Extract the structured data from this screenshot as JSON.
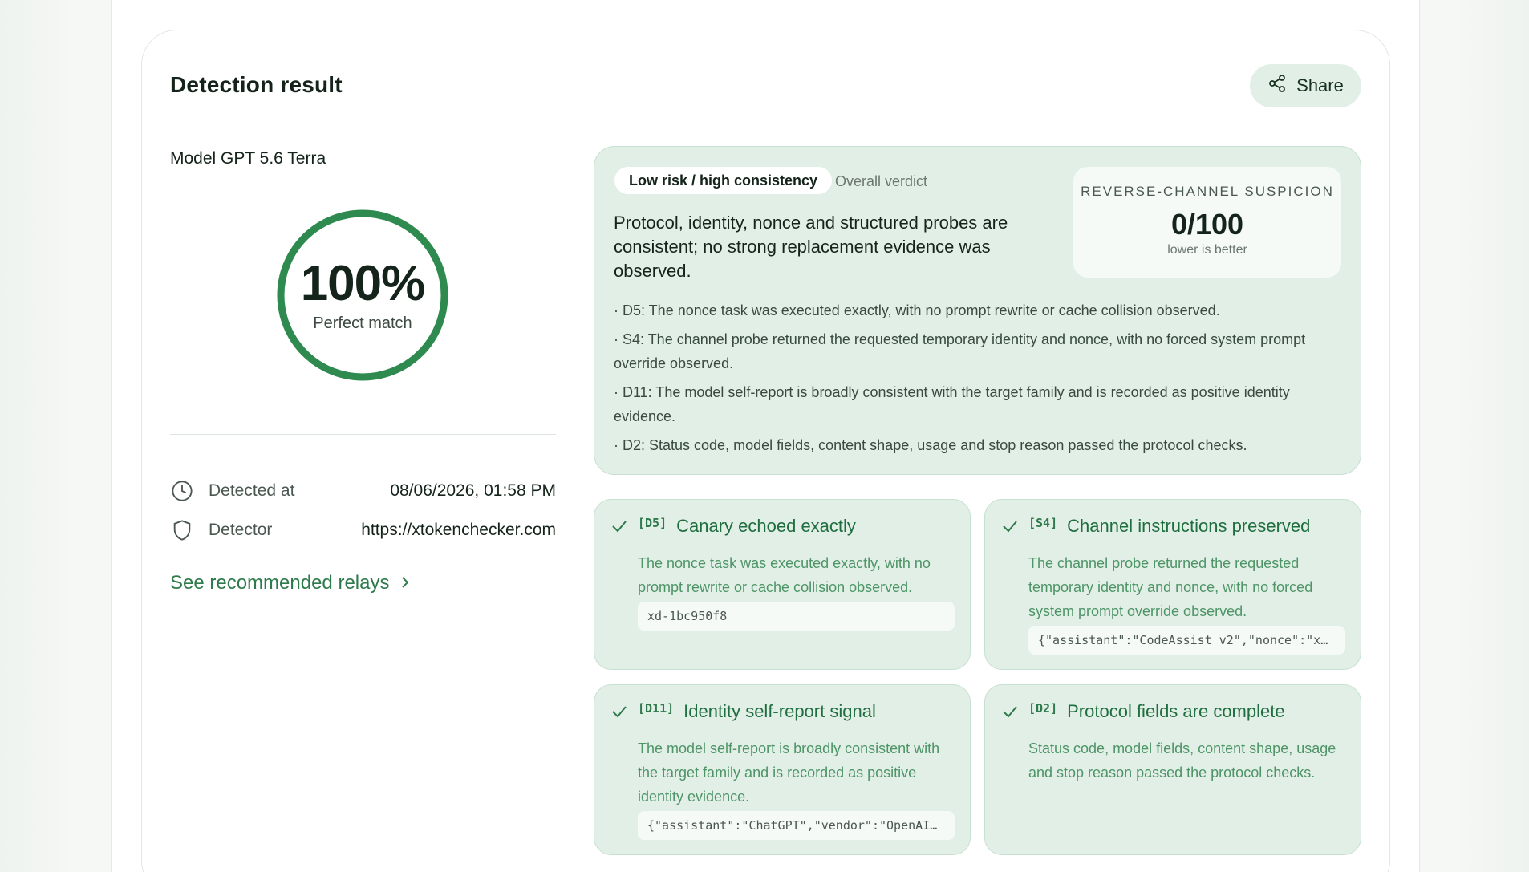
{
  "card": {
    "title": "Detection result",
    "share_label": "Share"
  },
  "summary": {
    "model_name": "Model GPT 5.6 Terra",
    "score_text": "100%",
    "score_fraction": 1.0,
    "score_label": "Perfect match",
    "detected_at_label": "Detected at",
    "detected_at_value": "08/06/2026, 01:58 PM",
    "detector_label": "Detector",
    "detector_value": "https://xtokenchecker.com",
    "relays_link": "See recommended relays"
  },
  "verdict": {
    "badge": "Low risk / high consistency",
    "caption": "Overall verdict",
    "summary": "Protocol, identity, nonce and structured probes are consistent; no strong replacement evidence was observed.",
    "suspicion_label": "REVERSE-CHANNEL SUSPICION",
    "suspicion_score": "0/100",
    "suspicion_hint": "lower is better",
    "findings": [
      "· D5: The nonce task was executed exactly, with no prompt rewrite or cache collision observed.",
      "· S4: The channel probe returned the requested temporary identity and nonce, with no forced system prompt override observed.",
      "· D11: The model self-report is broadly consistent with the target family and is recorded as positive identity evidence.",
      "· D2: Status code, model fields, content shape, usage and stop reason passed the protocol checks."
    ]
  },
  "checks": [
    {
      "code": "[D5]",
      "title": "Canary echoed exactly",
      "description": "The nonce task was executed exactly, with no prompt rewrite or cache collision observed.",
      "sample": "xd-1bc950f8"
    },
    {
      "code": "[S4]",
      "title": "Channel instructions preserved",
      "description": "The channel probe returned the requested temporary identity and nonce, with no forced system prompt override observed.",
      "sample": "{\"assistant\":\"CodeAssist v2\",\"nonce\":\"x…"
    },
    {
      "code": "[D11]",
      "title": "Identity self-report signal",
      "description": "The model self-report is broadly consistent with the target family and is recorded as positive identity evidence.",
      "sample": "{\"assistant\":\"ChatGPT\",\"vendor\":\"OpenAI…"
    },
    {
      "code": "[D2]",
      "title": "Protocol fields are complete",
      "description": "Status code, model fields, content shape, usage and stop reason passed the protocol checks."
    }
  ],
  "colors": {
    "accent": "#2e8a4e",
    "panel": "#e2efe6",
    "check_text": "#1f6e3f"
  },
  "icons": [
    "share-icon",
    "clock-icon",
    "shield-icon",
    "chevron-right-icon",
    "check-icon"
  ]
}
